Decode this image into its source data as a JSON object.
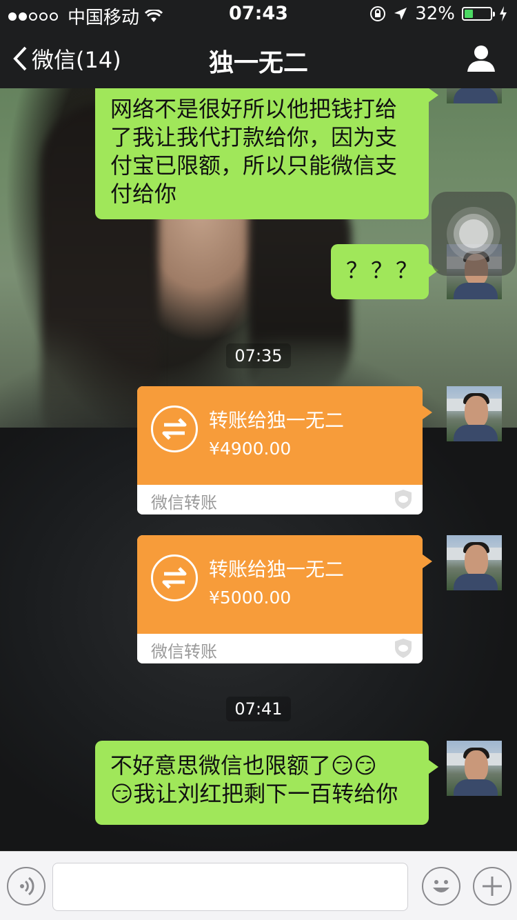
{
  "status_bar": {
    "carrier": "中国移动",
    "time": "07:43",
    "battery_percent": "32%",
    "battery_level": 0.32
  },
  "nav": {
    "back_label": "微信(14)",
    "title": "独一无二"
  },
  "messages": {
    "top_text_lines": [
      "网络不是很好所以他把钱打给",
      "了我让我代打款给你，因为支",
      "付宝已限额，所以只能微信支",
      "付给你"
    ],
    "question_text": "？？？",
    "time_1": "07:35",
    "transfer_1": {
      "title": "转账给独一无二",
      "amount": "¥4900.00",
      "footer": "微信转账"
    },
    "transfer_2": {
      "title": "转账给独一无二",
      "amount": "¥5000.00",
      "footer": "微信转账"
    },
    "time_2": "07:41",
    "last_line_1": "不好意思微信也限额了",
    "last_line_2": "我让刘红把剩下一百转给你"
  },
  "input": {
    "placeholder": ""
  },
  "colors": {
    "bubble_green": "#a0e75a",
    "transfer_orange": "#f79c3a",
    "bar_dark": "#1d1e1f"
  }
}
